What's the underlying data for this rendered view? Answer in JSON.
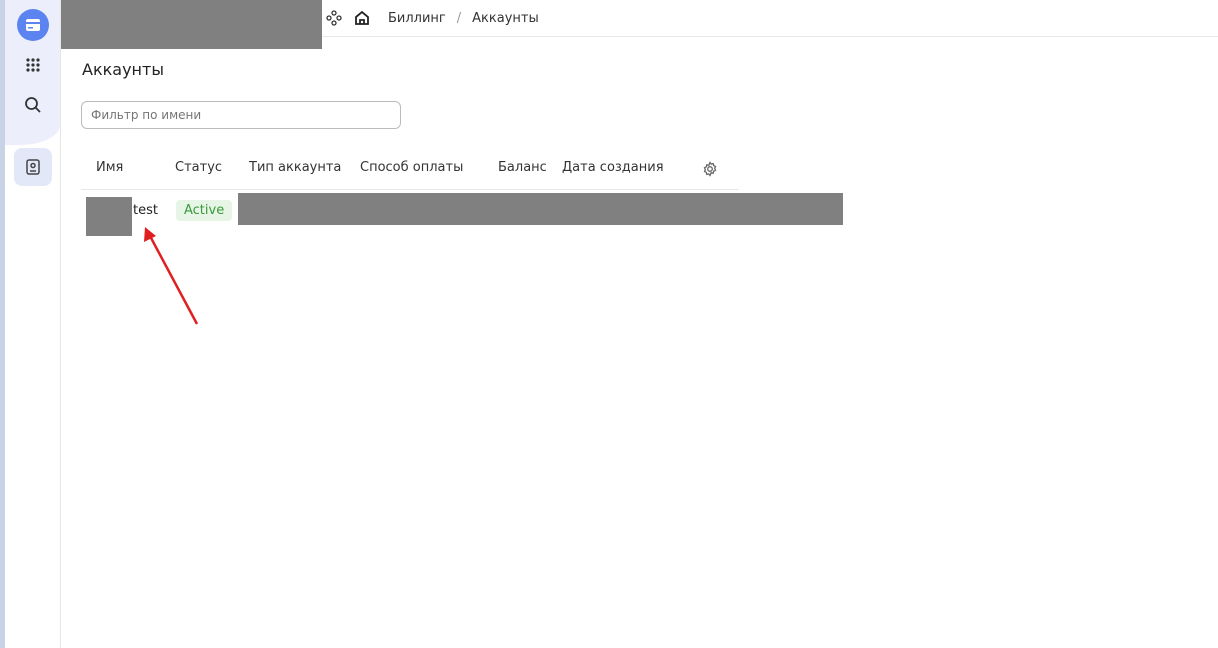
{
  "breadcrumb": {
    "items": [
      "Биллинг",
      "Аккаунты"
    ],
    "separator": "/"
  },
  "page": {
    "title": "Аккаунты"
  },
  "filter": {
    "placeholder": "Фильтр по имени",
    "value": ""
  },
  "table": {
    "columns": [
      "Имя",
      "Статус",
      "Тип аккаунта",
      "Способ оплаты",
      "Баланс",
      "Дата создания"
    ],
    "rows": [
      {
        "name": "test",
        "status": "Active"
      }
    ]
  },
  "colors": {
    "accent": "#5b84f0",
    "status_active": "#3a9a3a",
    "annotation_arrow": "#e02020"
  },
  "icons": [
    "billing-logo-icon",
    "apps-grid-icon",
    "search-icon",
    "account-card-icon",
    "services-icon",
    "home-icon",
    "gear-icon"
  ]
}
